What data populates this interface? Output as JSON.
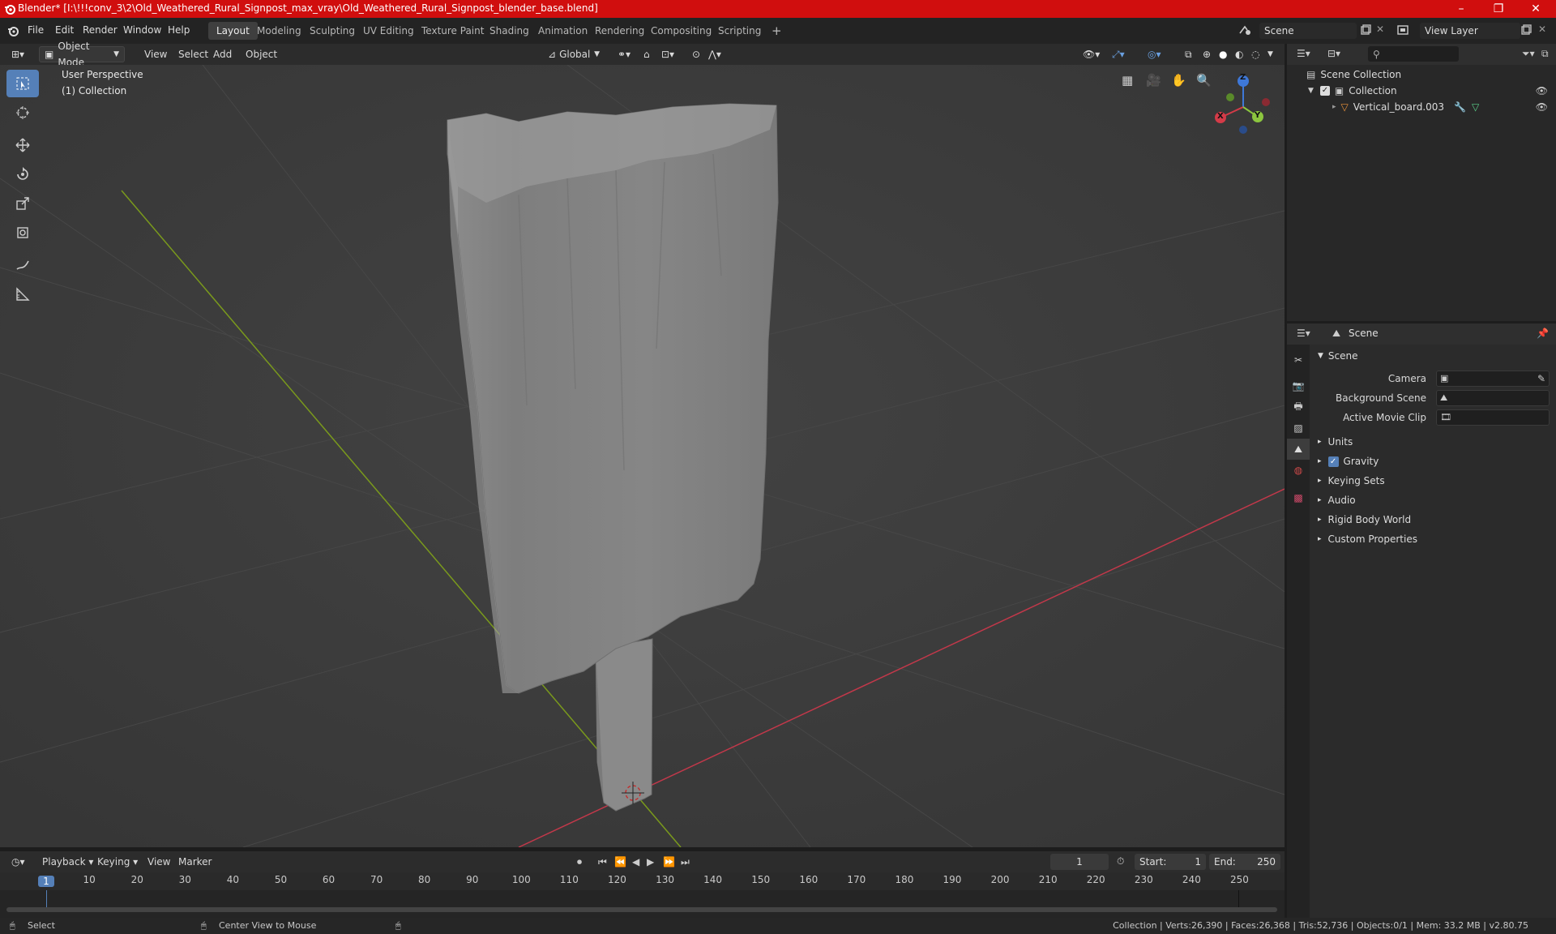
{
  "window": {
    "title": "Blender* [I:\\!!!conv_3\\2\\Old_Weathered_Rural_Signpost_max_vray\\Old_Weathered_Rural_Signpost_blender_base.blend]",
    "minimize": "–",
    "maximize": "❐",
    "close": "✕"
  },
  "menubar": [
    "File",
    "Edit",
    "Render",
    "Window",
    "Help"
  ],
  "workspaces": [
    "Layout",
    "Modeling",
    "Sculpting",
    "UV Editing",
    "Texture Paint",
    "Shading",
    "Animation",
    "Rendering",
    "Compositing",
    "Scripting"
  ],
  "active_workspace": "Layout",
  "add_workspace": "+",
  "scene_field": "Scene",
  "view_layer_field": "View Layer",
  "viewport_header": {
    "mode": "Object Mode",
    "menus": [
      "View",
      "Select",
      "Add",
      "Object"
    ],
    "transform": "Global"
  },
  "viewport": {
    "perspective": "User Perspective",
    "collection": "(1) Collection",
    "gizmo": {
      "x": "X",
      "y": "Y",
      "z": "Z"
    },
    "colors": {
      "bg": "#3c3c3c",
      "x_axis": "#c2384a",
      "y_axis": "#7a9a1c",
      "grid": "#474747",
      "mesh": "#8a8a8a"
    }
  },
  "outliner": {
    "root": "Scene Collection",
    "collection": "Collection",
    "object": "Vertical_board.003"
  },
  "properties": {
    "context": "Scene",
    "panel": "Scene",
    "rows": [
      {
        "label": "Camera"
      },
      {
        "label": "Background Scene"
      },
      {
        "label": "Active Movie Clip"
      }
    ],
    "sections": [
      "Units",
      "Gravity",
      "Keying Sets",
      "Audio",
      "Rigid Body World",
      "Custom Properties"
    ],
    "gravity_checked": true
  },
  "timeline": {
    "menus": [
      "Playback",
      "Keying",
      "View",
      "Marker"
    ],
    "current_frame": "1",
    "start_label": "Start:",
    "start": "1",
    "end_label": "End:",
    "end": "250",
    "ticks": [
      "1",
      "10",
      "20",
      "30",
      "40",
      "50",
      "60",
      "70",
      "80",
      "90",
      "100",
      "110",
      "120",
      "130",
      "140",
      "150",
      "160",
      "170",
      "180",
      "190",
      "200",
      "210",
      "220",
      "230",
      "240",
      "250"
    ]
  },
  "status": {
    "left": "Select",
    "middle": "Center View to Mouse",
    "right": "Collection | Verts:26,390 | Faces:26,368 | Tris:52,736 | Objects:0/1 | Mem: 33.2 MB | v2.80.75"
  }
}
